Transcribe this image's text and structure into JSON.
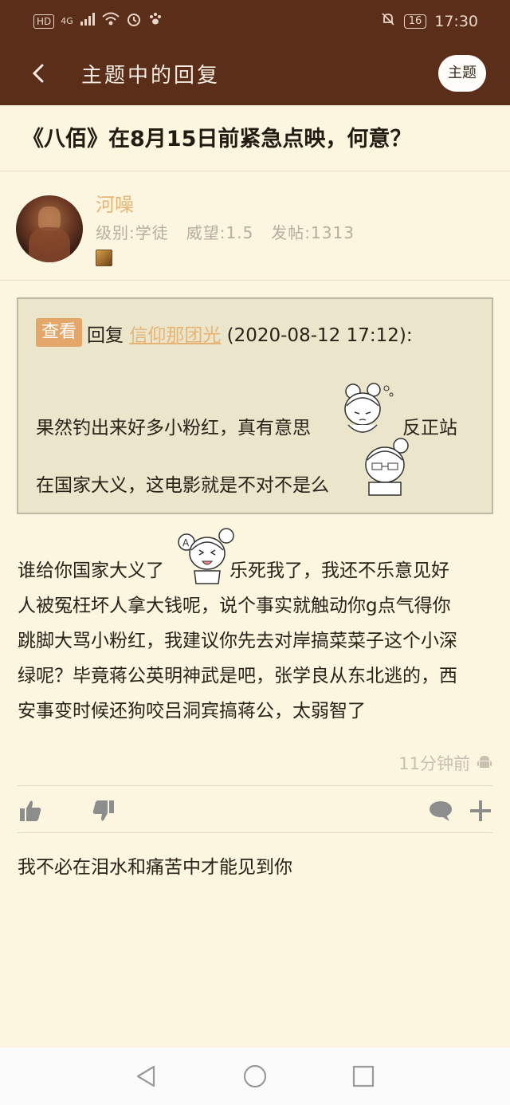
{
  "status_bar": {
    "hd_label": "HD",
    "network_label": "4G",
    "battery_level": "16",
    "time": "17:30"
  },
  "header": {
    "back_icon": "chevron-left-icon",
    "title": "主题中的回复",
    "topic_button_label": "主题"
  },
  "thread": {
    "title": "《八佰》在8月15日前紧急点映，何意？"
  },
  "author": {
    "name": "河噪",
    "level": "级别:学徒",
    "prestige": "威望:1.5",
    "posts": "发帖:1313"
  },
  "quote": {
    "view_label": "查看",
    "reply_prefix": "回复",
    "quoted_user": "信仰那团光",
    "quoted_time": "(2020-08-12 17:12):",
    "text_part1": "果然钓出来好多小粉红，真有意思",
    "text_part2": "反正站",
    "text_part3": "在国家大义，这电影就是不对不是么"
  },
  "post": {
    "line1_a": "谁给你国家大义了",
    "line1_b": "乐死我了，我还不乐意见好",
    "line2": "人被冤枉坏人拿大钱呢，说个事实就触动你g点气得你",
    "line3": "跳脚大骂小粉红，我建议你先去对岸搞菜菜子这个小深",
    "line4": "绿呢？毕竟蒋公英明神武是吧，张学良从东北逃的，西",
    "line5": "安事变时候还狗咬吕洞宾搞蒋公，太弱智了",
    "time": "11分钟前",
    "signature": "我不必在泪水和痛苦中才能见到你"
  },
  "actions": {
    "like_icon": "thumbs-up-icon",
    "dislike_icon": "thumbs-down-icon",
    "comment_icon": "comment-icon",
    "more_icon": "plus-icon"
  },
  "colors": {
    "header_bg": "#5b2e19",
    "page_bg": "#fcf5e0",
    "accent": "#e6b576",
    "quote_bg": "#ebe5cc"
  }
}
